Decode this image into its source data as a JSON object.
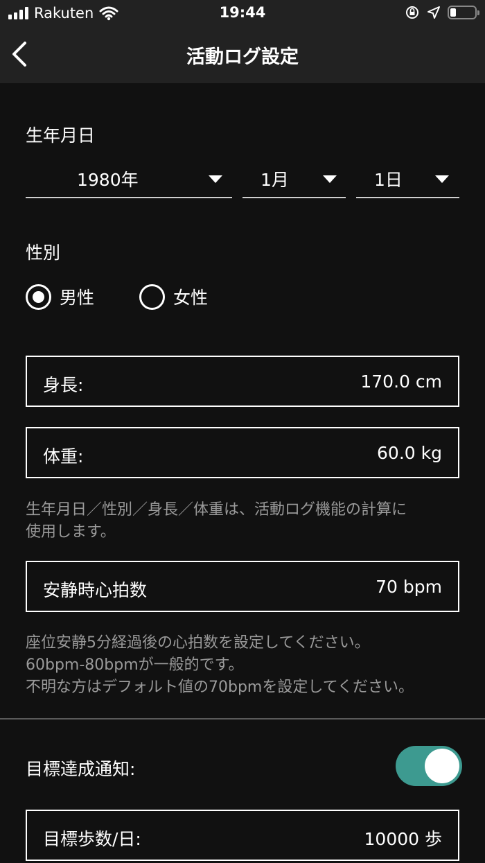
{
  "status_bar": {
    "carrier": "Rakuten",
    "time": "19:44"
  },
  "nav": {
    "title": "活動ログ設定"
  },
  "birthday": {
    "label": "生年月日",
    "year": "1980年",
    "month": "1月",
    "day": "1日"
  },
  "gender": {
    "label": "性別",
    "options": [
      "男性",
      "女性"
    ],
    "selected": "男性"
  },
  "height": {
    "label": "身長:",
    "value": "170.0 cm"
  },
  "weight": {
    "label": "体重:",
    "value": "60.0 kg"
  },
  "body_note": {
    "line1": "生年月日／性別／身長／体重は、活動ログ機能の計算に",
    "line2": "使用します。"
  },
  "resting_hr": {
    "label": "安静時心拍数",
    "value": "70 bpm"
  },
  "hr_note": {
    "line1": "座位安静5分経過後の心拍数を設定してください。",
    "line2": "60bpm-80bpmが一般的です。",
    "line3": "不明な方はデフォルト値の70bpmを設定してください。"
  },
  "goal_notification": {
    "label": "目標達成通知:",
    "enabled": true,
    "accent_color": "#3d9a90"
  },
  "goal_steps": {
    "label": "目標歩数/日:",
    "value": "10000 歩"
  }
}
